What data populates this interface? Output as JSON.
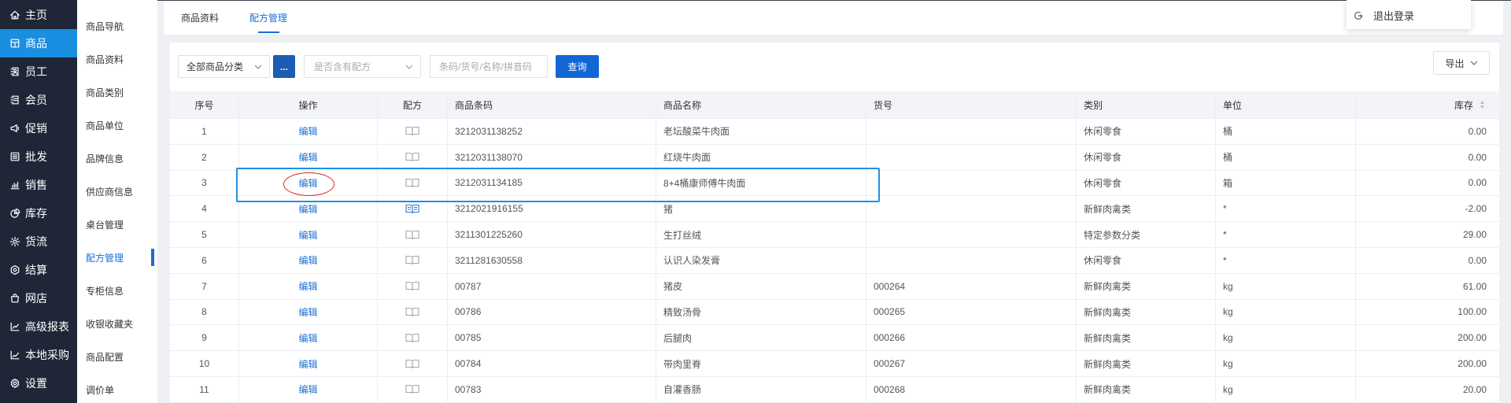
{
  "main_nav": {
    "items": [
      {
        "label": "主页",
        "icon": "home-icon"
      },
      {
        "label": "商品",
        "icon": "goods-icon",
        "active": true
      },
      {
        "label": "员工",
        "icon": "staff-icon"
      },
      {
        "label": "会员",
        "icon": "member-icon"
      },
      {
        "label": "促销",
        "icon": "promotion-icon"
      },
      {
        "label": "批发",
        "icon": "wholesale-icon"
      },
      {
        "label": "销售",
        "icon": "sales-icon"
      },
      {
        "label": "库存",
        "icon": "inventory-icon"
      },
      {
        "label": "货流",
        "icon": "logistics-icon"
      },
      {
        "label": "结算",
        "icon": "settlement-icon"
      },
      {
        "label": "网店",
        "icon": "shop-icon"
      },
      {
        "label": "高级报表",
        "icon": "report-icon"
      },
      {
        "label": "本地采购",
        "icon": "purchase-icon"
      },
      {
        "label": "设置",
        "icon": "settings-icon"
      }
    ]
  },
  "sub_nav": {
    "items": [
      {
        "label": "商品导航"
      },
      {
        "label": "商品资料"
      },
      {
        "label": "商品类别"
      },
      {
        "label": "商品单位"
      },
      {
        "label": "品牌信息"
      },
      {
        "label": "供应商信息"
      },
      {
        "label": "桌台管理"
      },
      {
        "label": "配方管理",
        "active": true
      },
      {
        "label": "专柜信息"
      },
      {
        "label": "收银收藏夹"
      },
      {
        "label": "商品配置"
      },
      {
        "label": "调价单"
      }
    ]
  },
  "tabs": [
    {
      "label": "商品资料"
    },
    {
      "label": "配方管理",
      "active": true
    }
  ],
  "user_menu": {
    "logout_label": "退出登录",
    "logout_icon": "logout-icon"
  },
  "filters": {
    "category_select": {
      "value": "全部商品分类"
    },
    "more_button": {
      "label": "..."
    },
    "formula_select": {
      "placeholder": "是否含有配方"
    },
    "search_input": {
      "value": "",
      "placeholder": "条码/货号/名称/拼音码"
    },
    "query_button": {
      "label": "查询"
    },
    "export_button": {
      "label": "导出"
    }
  },
  "table": {
    "columns": [
      "序号",
      "操作",
      "配方",
      "商品条码",
      "商品名称",
      "货号",
      "类别",
      "单位",
      "库存"
    ],
    "action_label": "编辑",
    "rows": [
      {
        "no": "1",
        "barcode": "3212031138252",
        "name": "老坛酸菜牛肉面",
        "sku": "",
        "category": "休闲零食",
        "unit": "桶",
        "stock": "0.00",
        "has_formula": false
      },
      {
        "no": "2",
        "barcode": "3212031138070",
        "name": "红烧牛肉面",
        "sku": "",
        "category": "休闲零食",
        "unit": "桶",
        "stock": "0.00",
        "has_formula": false
      },
      {
        "no": "3",
        "barcode": "3212031134185",
        "name": "8+4桶康师傅牛肉面",
        "sku": "",
        "category": "休闲零食",
        "unit": "箱",
        "stock": "0.00",
        "has_formula": false
      },
      {
        "no": "4",
        "barcode": "3212021916155",
        "name": "猪",
        "sku": "",
        "category": "新鲜肉禽类",
        "unit": "*",
        "stock": "-2.00",
        "has_formula": true
      },
      {
        "no": "5",
        "barcode": "3211301225260",
        "name": "生打丝绒",
        "sku": "",
        "category": "特定参数分类",
        "unit": "*",
        "stock": "29.00",
        "has_formula": false
      },
      {
        "no": "6",
        "barcode": "3211281630558",
        "name": "认识人染发膏",
        "sku": "",
        "category": "休闲零食",
        "unit": "*",
        "stock": "0.00",
        "has_formula": false
      },
      {
        "no": "7",
        "barcode": "00787",
        "name": "猪皮",
        "sku": "000264",
        "category": "新鲜肉禽类",
        "unit": "kg",
        "stock": "61.00",
        "has_formula": false
      },
      {
        "no": "8",
        "barcode": "00786",
        "name": "精致汤骨",
        "sku": "000265",
        "category": "新鲜肉禽类",
        "unit": "kg",
        "stock": "100.00",
        "has_formula": false
      },
      {
        "no": "9",
        "barcode": "00785",
        "name": "后腿肉",
        "sku": "000266",
        "category": "新鲜肉禽类",
        "unit": "kg",
        "stock": "200.00",
        "has_formula": false
      },
      {
        "no": "10",
        "barcode": "00784",
        "name": "带肉里脊",
        "sku": "000267",
        "category": "新鲜肉禽类",
        "unit": "kg",
        "stock": "200.00",
        "has_formula": false
      },
      {
        "no": "11",
        "barcode": "00783",
        "name": "自灌香肠",
        "sku": "000268",
        "category": "新鲜肉禽类",
        "unit": "kg",
        "stock": "20.00",
        "has_formula": false
      }
    ]
  },
  "colors": {
    "nav_background": "#1f2637",
    "nav_active": "#1a8ee0",
    "accent": "#1a6fd3",
    "primary_button": "#1366d6",
    "more_button": "#1b5cb4",
    "formula_icon_on": "#2a7bd6",
    "formula_icon_off": "#a3a8b0",
    "annotation_box": "#1e8fe6",
    "annotation_circle": "#e3251e"
  }
}
